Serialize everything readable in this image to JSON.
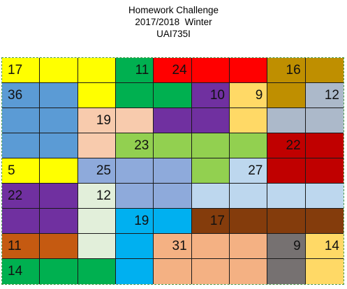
{
  "header": {
    "title": "Homework Challenge",
    "term": "2017/2018  Winter",
    "code": "UAI735I"
  },
  "colors": {
    "Y": "#ffff00",
    "B": "#5b9bd5",
    "G": "#00b050",
    "R": "#ff0000",
    "O": "#bf8f00",
    "P": "#7030a0",
    "L": "#ffd966",
    "S": "#acb9ca",
    "K": "#f8cbad",
    "E": "#92d050",
    "D": "#c00000",
    "M": "#8eaadb",
    "C": "#bdd7ee",
    "W": "#e2efda",
    "A": "#00b0f0",
    "N": "#843c0c",
    "T": "#c55a11",
    "X": "#f4b183",
    "H": "#767171"
  },
  "grid": [
    [
      "Y",
      "Y",
      "Y",
      "G",
      "R",
      "R",
      "R",
      "O",
      "O"
    ],
    [
      "B",
      "B",
      "Y",
      "G",
      "G",
      "P",
      "L",
      "O",
      "S"
    ],
    [
      "B",
      "B",
      "K",
      "K",
      "P",
      "P",
      "L",
      "S",
      "S"
    ],
    [
      "B",
      "B",
      "K",
      "E",
      "E",
      "E",
      "E",
      "D",
      "D"
    ],
    [
      "Y",
      "Y",
      "M",
      "M",
      "M",
      "E",
      "C",
      "D",
      "D"
    ],
    [
      "P",
      "P",
      "W",
      "M",
      "M",
      "C",
      "C",
      "C",
      "C"
    ],
    [
      "P",
      "P",
      "W",
      "A",
      "A",
      "N",
      "N",
      "N",
      "N"
    ],
    [
      "T",
      "T",
      "W",
      "A",
      "X",
      "X",
      "X",
      "H",
      "L"
    ],
    [
      "G",
      "G",
      "G",
      "A",
      "X",
      "X",
      "X",
      "H",
      "L"
    ]
  ],
  "cells": [
    [
      "17",
      "",
      "",
      "11",
      "24",
      "",
      "",
      "16",
      ""
    ],
    [
      "36",
      "",
      "",
      "",
      "",
      "10",
      "9",
      "",
      "12"
    ],
    [
      "",
      "",
      "19",
      "",
      "",
      "",
      "",
      "",
      ""
    ],
    [
      "",
      "",
      "",
      "23",
      "",
      "",
      "",
      "22",
      ""
    ],
    [
      "5",
      "",
      "25",
      "",
      "",
      "",
      "27",
      "",
      ""
    ],
    [
      "22",
      "",
      "12",
      "",
      "",
      "",
      "",
      "",
      ""
    ],
    [
      "",
      "",
      "",
      "19",
      "",
      "17",
      "",
      "",
      ""
    ],
    [
      "11",
      "",
      "",
      "",
      "31",
      "",
      "",
      "9",
      "14"
    ],
    [
      "14",
      "",
      "",
      "",
      "",
      "",
      "",
      "",
      ""
    ]
  ]
}
